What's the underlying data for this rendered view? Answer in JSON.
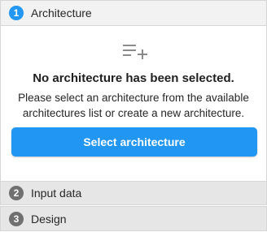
{
  "steps": [
    {
      "number": "1",
      "label": "Architecture",
      "state": "active"
    },
    {
      "number": "2",
      "label": "Input data",
      "state": "inactive"
    },
    {
      "number": "3",
      "label": "Design",
      "state": "inactive"
    }
  ],
  "empty_state": {
    "icon": "playlist-add-icon",
    "title": "No architecture has been selected.",
    "description": "Please select an architecture from the available architectures list or create a new architecture.",
    "button_label": "Select architecture"
  },
  "colors": {
    "accent": "#2196f3",
    "inactive_badge": "#707070",
    "icon_gray": "#8a8a8a"
  }
}
